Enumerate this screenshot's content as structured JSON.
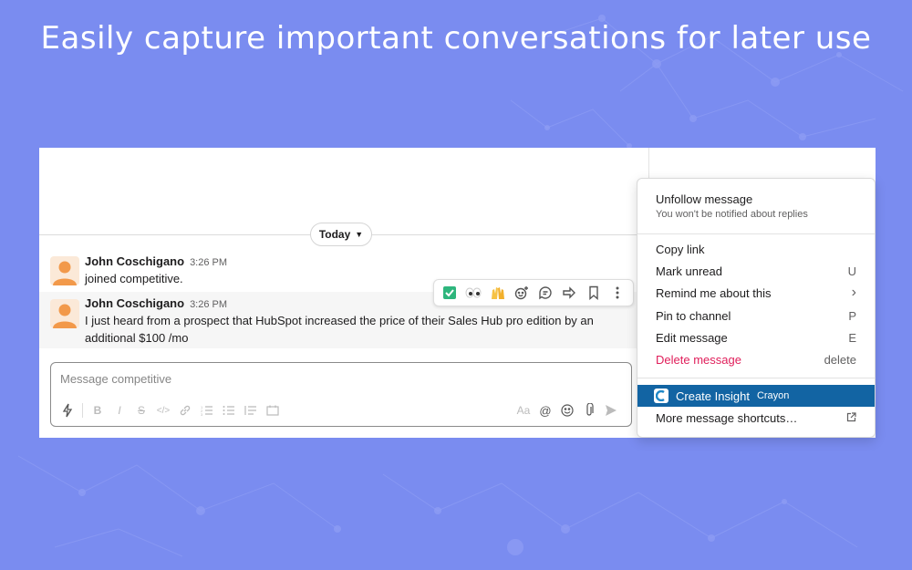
{
  "headline": "Easily capture important conversations for later use",
  "channel": {
    "day_divider": "Today",
    "messages": [
      {
        "author": "John Coschigano",
        "time": "3:26 PM",
        "text": "joined competitive."
      },
      {
        "author": "John Coschigano",
        "time": "3:26 PM",
        "text": "I just heard from a prospect that HubSpot increased the price of their Sales Hub pro edition by an additional $100 /mo"
      }
    ],
    "hover_actions": [
      "check-reaction",
      "eyes-reaction",
      "raised-hands-reaction",
      "add-reaction",
      "reply-in-thread",
      "share-message",
      "save-message",
      "more-actions"
    ]
  },
  "composer": {
    "placeholder": "Message competitive",
    "toolbar": [
      "shortcuts",
      "bold",
      "italic",
      "strikethrough",
      "code",
      "link",
      "ordered-list",
      "bulleted-list",
      "blockquote",
      "code-block",
      "formatting",
      "mention",
      "emoji",
      "attach",
      "send"
    ],
    "format_label": "Aa"
  },
  "menu": {
    "unfollow": {
      "label": "Unfollow message",
      "sub": "You won't be notified about replies"
    },
    "items": [
      {
        "label": "Copy link",
        "shortcut": ""
      },
      {
        "label": "Mark unread",
        "shortcut": "U"
      },
      {
        "label": "Remind me about this",
        "shortcut": "›"
      },
      {
        "label": "Pin to channel",
        "shortcut": "P"
      },
      {
        "label": "Edit message",
        "shortcut": "E"
      },
      {
        "label": "Delete message",
        "shortcut": "delete"
      }
    ],
    "create_insight": {
      "label": "Create Insight",
      "app": "Crayon"
    },
    "more_shortcuts": "More message shortcuts…"
  },
  "colors": {
    "background": "#7a8cf0",
    "accent": "#1264a3",
    "danger": "#e01e5a"
  }
}
